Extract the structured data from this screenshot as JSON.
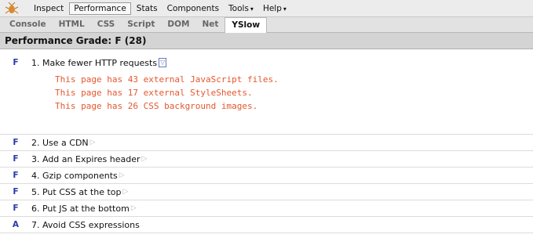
{
  "menubar": {
    "items": [
      {
        "label": "Inspect"
      },
      {
        "label": "Performance"
      },
      {
        "label": "Stats"
      },
      {
        "label": "Components"
      },
      {
        "label": "Tools"
      },
      {
        "label": "Help"
      }
    ],
    "caret": "▾"
  },
  "tabs": [
    {
      "label": "Console"
    },
    {
      "label": "HTML"
    },
    {
      "label": "CSS"
    },
    {
      "label": "Script"
    },
    {
      "label": "DOM"
    },
    {
      "label": "Net"
    },
    {
      "label": "YSlow"
    }
  ],
  "grade_header": "Performance Grade: F (28)",
  "expanded_rule": {
    "grade": "F",
    "label": "1. Make fewer HTTP requests",
    "details": [
      "This page has 43 external JavaScript files.",
      "This page has 17 external StyleSheets.",
      "This page has 26 CSS background images."
    ]
  },
  "rules": [
    {
      "grade": "F",
      "label": "2. Use a CDN"
    },
    {
      "grade": "F",
      "label": "3. Add an Expires header"
    },
    {
      "grade": "F",
      "label": "4. Gzip components"
    },
    {
      "grade": "F",
      "label": "5. Put CSS at the top"
    },
    {
      "grade": "F",
      "label": "6. Put JS at the bottom"
    },
    {
      "grade": "A",
      "label": "7. Avoid CSS expressions"
    }
  ],
  "icons": {
    "logo": "firebug-bug-icon",
    "expand_open": "expand-triangle-icon",
    "expand_closed": "expand-triangle-icon"
  },
  "colors": {
    "grade": "#2a3aa8",
    "detail_text": "#e4572e"
  }
}
